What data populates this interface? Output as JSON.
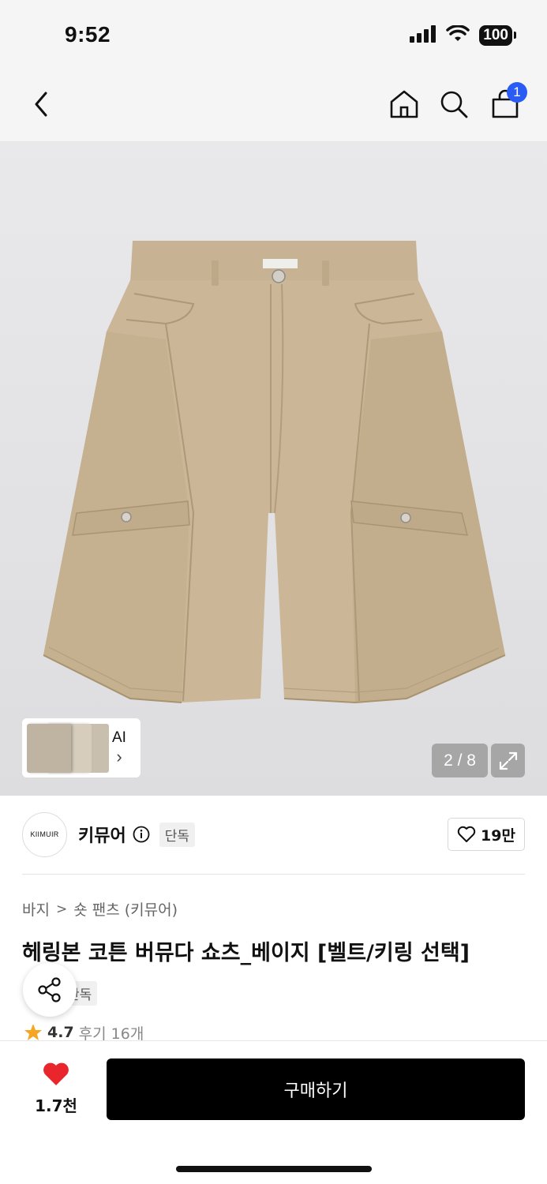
{
  "status_bar": {
    "time": "9:52",
    "battery": "100"
  },
  "nav": {
    "cart_count": "1"
  },
  "gallery": {
    "page_counter": "2 / 8",
    "ai_label": "AI",
    "ai_chevron": "›"
  },
  "brand": {
    "logo_text": "KIIMUIR",
    "name": "키뮤어",
    "tag": "단독",
    "like_count": "19만"
  },
  "breadcrumb": {
    "category": "바지",
    "separator": ">",
    "subcategory": "숏 팬츠 (키뮤어)"
  },
  "product": {
    "title": "헤링본 코튼 버뮤다 쇼츠_베이지 [벨트/키링 선택]",
    "tag": "단독",
    "rating": "4.7",
    "reviews": "후기 16개"
  },
  "bottom": {
    "wish_count": "1.7천",
    "buy_label": "구매하기"
  },
  "colors": {
    "accent_blue": "#2a5cf5",
    "heart_red": "#e8262b",
    "star_orange": "#f5a623",
    "product_beige": "#c9b595"
  },
  "icons": [
    "signal-icon",
    "wifi-icon",
    "back-chevron-icon",
    "home-icon",
    "search-icon",
    "cart-icon",
    "expand-icon",
    "info-icon",
    "heart-outline-icon",
    "share-icon",
    "star-icon",
    "heart-filled-icon"
  ]
}
